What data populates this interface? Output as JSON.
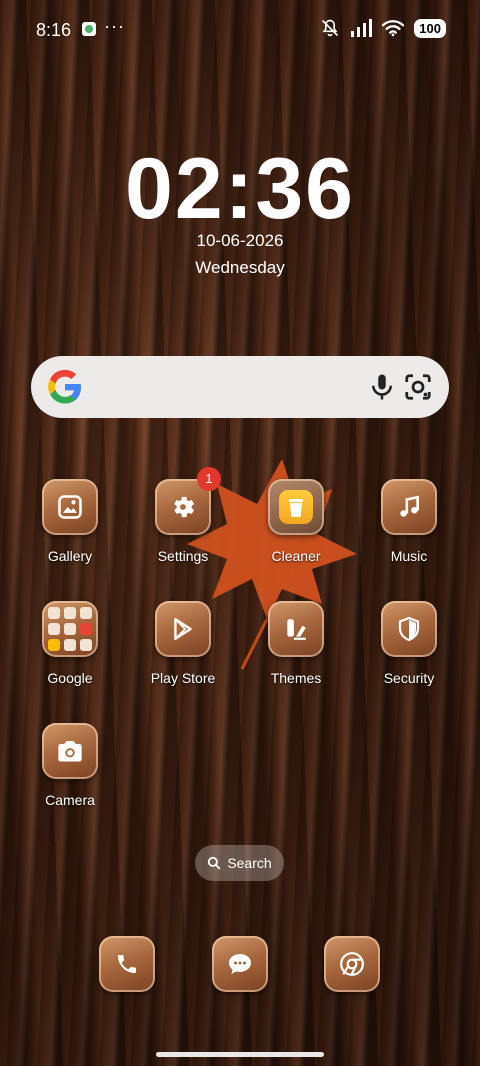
{
  "status_bar": {
    "time": "8:16",
    "dots": "···",
    "battery": "100"
  },
  "clock": {
    "time": "02:36",
    "date": "10-06-2026",
    "day": "Wednesday"
  },
  "search_widget": {
    "logo": "G"
  },
  "apps": [
    {
      "label": "Gallery",
      "icon": "gallery-icon"
    },
    {
      "label": "Settings",
      "icon": "gear-icon",
      "badge": "1"
    },
    {
      "label": "Cleaner",
      "icon": "trash-icon"
    },
    {
      "label": "Music",
      "icon": "music-note-icon"
    },
    {
      "label": "Google",
      "icon": "folder-icon"
    },
    {
      "label": "Play Store",
      "icon": "play-store-icon"
    },
    {
      "label": "Themes",
      "icon": "themes-icon"
    },
    {
      "label": "Security",
      "icon": "shield-icon"
    },
    {
      "label": "Camera",
      "icon": "camera-icon"
    }
  ],
  "app_search": {
    "label": "Search"
  },
  "dock": [
    {
      "icon": "phone-icon"
    },
    {
      "icon": "messages-icon"
    },
    {
      "icon": "chrome-icon"
    }
  ]
}
